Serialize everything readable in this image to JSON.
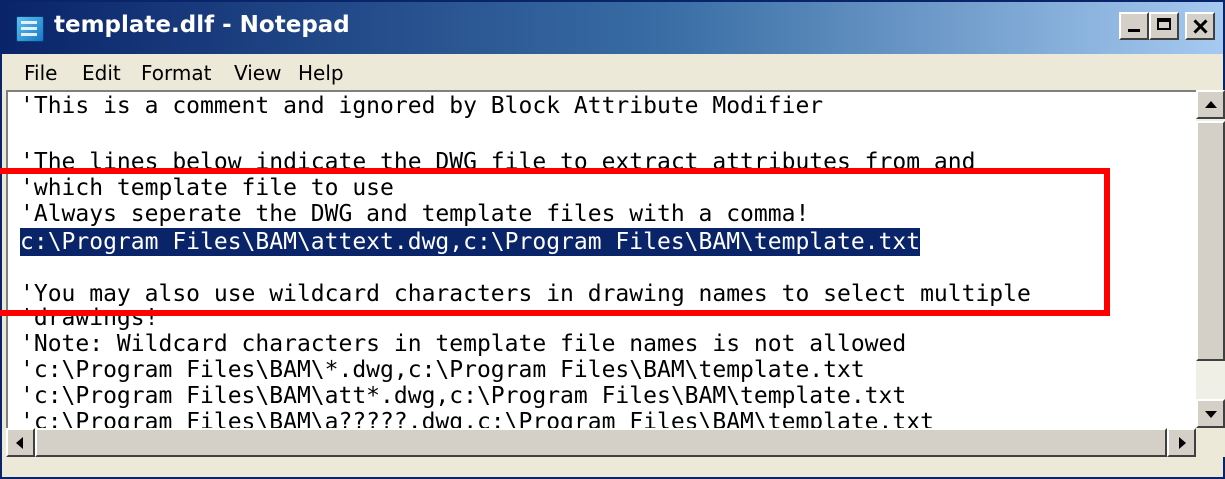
{
  "window": {
    "title": "template.dlf - Notepad"
  },
  "menu": {
    "file": "File",
    "edit": "Edit",
    "format": "Format",
    "view": "View",
    "help": "Help"
  },
  "editor": {
    "lines": [
      "'This is a comment and ignored by Block Attribute Modifier",
      "",
      "'The lines below indicate the DWG file to extract attributes from and",
      "'which template file to use",
      "'Always seperate the DWG and template files with a comma!",
      "c:\\Program Files\\BAM\\attext.dwg,c:\\Program Files\\BAM\\template.txt",
      "",
      "'You may also use wildcard characters in drawing names to select multiple",
      "'drawings!",
      "'Note: Wildcard characters in template file names is not allowed",
      "'c:\\Program Files\\BAM\\*.dwg,c:\\Program Files\\BAM\\template.txt",
      "'c:\\Program Files\\BAM\\att*.dwg,c:\\Program Files\\BAM\\template.txt",
      "'c:\\Program Files\\BAM\\a?????.dwg,c:\\Program Files\\BAM\\template.txt"
    ],
    "selected_line_index": 5
  },
  "colors": {
    "selection_bg": "#0a246a",
    "highlight_border": "#ff0000"
  }
}
